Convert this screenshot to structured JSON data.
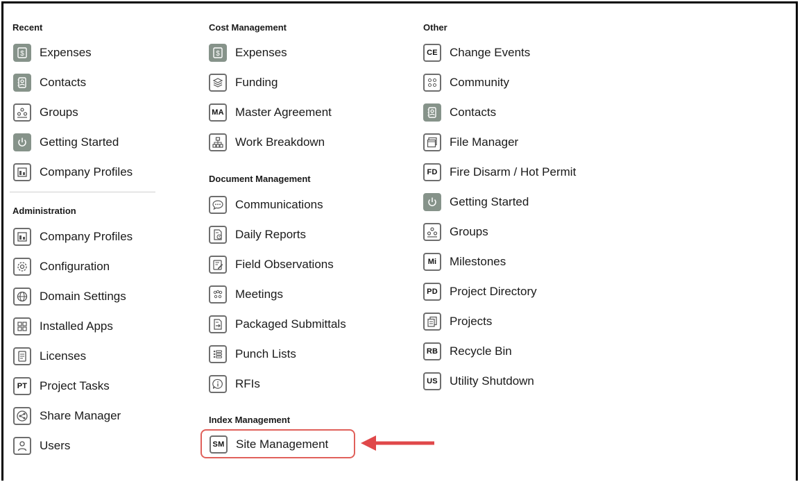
{
  "columns": {
    "recent": {
      "header": "Recent",
      "items": [
        {
          "label": "Expenses",
          "icon": "dollar-icon"
        },
        {
          "label": "Contacts",
          "icon": "contacts-icon"
        },
        {
          "label": "Groups",
          "icon": "groups-icon"
        },
        {
          "label": "Getting Started",
          "icon": "power-icon"
        },
        {
          "label": "Company Profiles",
          "icon": "company-icon"
        }
      ]
    },
    "administration": {
      "header": "Administration",
      "items": [
        {
          "label": "Company Profiles",
          "icon": "company-icon"
        },
        {
          "label": "Configuration",
          "icon": "gear-icon"
        },
        {
          "label": "Domain Settings",
          "icon": "globe-icon"
        },
        {
          "label": "Installed Apps",
          "icon": "apps-icon"
        },
        {
          "label": "Licenses",
          "icon": "license-icon"
        },
        {
          "label": "Project Tasks",
          "icon": "PT"
        },
        {
          "label": "Share Manager",
          "icon": "share-icon"
        },
        {
          "label": "Users",
          "icon": "user-icon"
        }
      ]
    },
    "cost_management": {
      "header": "Cost Management",
      "items": [
        {
          "label": "Expenses",
          "icon": "dollar-icon"
        },
        {
          "label": "Funding",
          "icon": "funding-icon"
        },
        {
          "label": "Master Agreement",
          "icon": "MA"
        },
        {
          "label": "Work Breakdown",
          "icon": "hierarchy-icon"
        }
      ]
    },
    "document_management": {
      "header": "Document Management",
      "items": [
        {
          "label": "Communications",
          "icon": "chat-icon"
        },
        {
          "label": "Daily Reports",
          "icon": "report-icon"
        },
        {
          "label": "Field Observations",
          "icon": "observation-icon"
        },
        {
          "label": "Meetings",
          "icon": "meetings-icon"
        },
        {
          "label": "Packaged Submittals",
          "icon": "submittals-icon"
        },
        {
          "label": "Punch Lists",
          "icon": "list-icon"
        },
        {
          "label": "RFIs",
          "icon": "rfi-icon"
        }
      ]
    },
    "index_management": {
      "header": "Index Management",
      "items": [
        {
          "label": "Site Management",
          "icon": "SM"
        }
      ]
    },
    "other": {
      "header": "Other",
      "items": [
        {
          "label": "Change Events",
          "icon": "CE"
        },
        {
          "label": "Community",
          "icon": "community-icon"
        },
        {
          "label": "Contacts",
          "icon": "contacts-icon"
        },
        {
          "label": "File Manager",
          "icon": "folder-icon"
        },
        {
          "label": "Fire Disarm / Hot Permit",
          "icon": "FD"
        },
        {
          "label": "Getting Started",
          "icon": "power-icon"
        },
        {
          "label": "Groups",
          "icon": "groups-icon"
        },
        {
          "label": "Milestones",
          "icon": "Mi"
        },
        {
          "label": "Project Directory",
          "icon": "PD"
        },
        {
          "label": "Projects",
          "icon": "projects-icon"
        },
        {
          "label": "Recycle Bin",
          "icon": "RB"
        },
        {
          "label": "Utility Shutdown",
          "icon": "US"
        }
      ]
    }
  },
  "colors": {
    "icon_fill": "#86938a",
    "highlight": "#e0605a",
    "arrow": "#e0484a"
  }
}
